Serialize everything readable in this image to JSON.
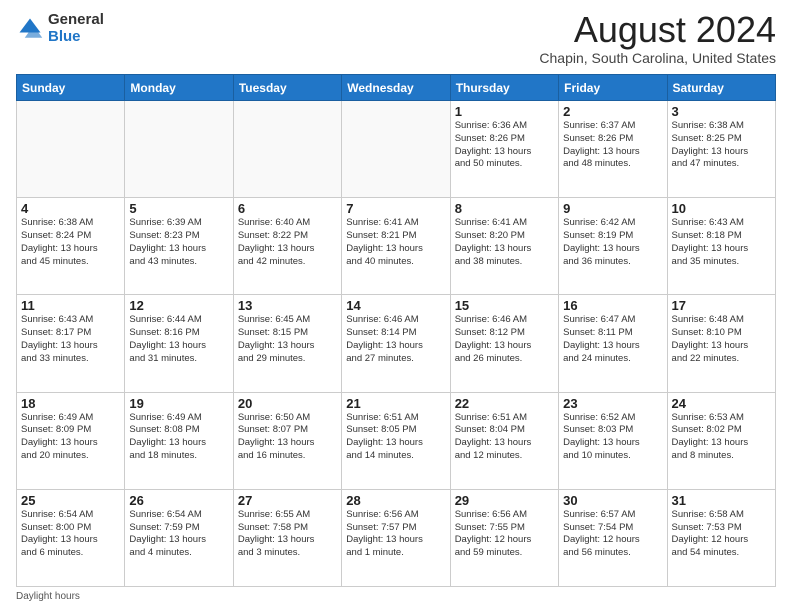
{
  "header": {
    "logo_general": "General",
    "logo_blue": "Blue",
    "month_year": "August 2024",
    "location": "Chapin, South Carolina, United States"
  },
  "days_of_week": [
    "Sunday",
    "Monday",
    "Tuesday",
    "Wednesday",
    "Thursday",
    "Friday",
    "Saturday"
  ],
  "weeks": [
    [
      {
        "day": "",
        "info": ""
      },
      {
        "day": "",
        "info": ""
      },
      {
        "day": "",
        "info": ""
      },
      {
        "day": "",
        "info": ""
      },
      {
        "day": "1",
        "info": "Sunrise: 6:36 AM\nSunset: 8:26 PM\nDaylight: 13 hours\nand 50 minutes."
      },
      {
        "day": "2",
        "info": "Sunrise: 6:37 AM\nSunset: 8:26 PM\nDaylight: 13 hours\nand 48 minutes."
      },
      {
        "day": "3",
        "info": "Sunrise: 6:38 AM\nSunset: 8:25 PM\nDaylight: 13 hours\nand 47 minutes."
      }
    ],
    [
      {
        "day": "4",
        "info": "Sunrise: 6:38 AM\nSunset: 8:24 PM\nDaylight: 13 hours\nand 45 minutes."
      },
      {
        "day": "5",
        "info": "Sunrise: 6:39 AM\nSunset: 8:23 PM\nDaylight: 13 hours\nand 43 minutes."
      },
      {
        "day": "6",
        "info": "Sunrise: 6:40 AM\nSunset: 8:22 PM\nDaylight: 13 hours\nand 42 minutes."
      },
      {
        "day": "7",
        "info": "Sunrise: 6:41 AM\nSunset: 8:21 PM\nDaylight: 13 hours\nand 40 minutes."
      },
      {
        "day": "8",
        "info": "Sunrise: 6:41 AM\nSunset: 8:20 PM\nDaylight: 13 hours\nand 38 minutes."
      },
      {
        "day": "9",
        "info": "Sunrise: 6:42 AM\nSunset: 8:19 PM\nDaylight: 13 hours\nand 36 minutes."
      },
      {
        "day": "10",
        "info": "Sunrise: 6:43 AM\nSunset: 8:18 PM\nDaylight: 13 hours\nand 35 minutes."
      }
    ],
    [
      {
        "day": "11",
        "info": "Sunrise: 6:43 AM\nSunset: 8:17 PM\nDaylight: 13 hours\nand 33 minutes."
      },
      {
        "day": "12",
        "info": "Sunrise: 6:44 AM\nSunset: 8:16 PM\nDaylight: 13 hours\nand 31 minutes."
      },
      {
        "day": "13",
        "info": "Sunrise: 6:45 AM\nSunset: 8:15 PM\nDaylight: 13 hours\nand 29 minutes."
      },
      {
        "day": "14",
        "info": "Sunrise: 6:46 AM\nSunset: 8:14 PM\nDaylight: 13 hours\nand 27 minutes."
      },
      {
        "day": "15",
        "info": "Sunrise: 6:46 AM\nSunset: 8:12 PM\nDaylight: 13 hours\nand 26 minutes."
      },
      {
        "day": "16",
        "info": "Sunrise: 6:47 AM\nSunset: 8:11 PM\nDaylight: 13 hours\nand 24 minutes."
      },
      {
        "day": "17",
        "info": "Sunrise: 6:48 AM\nSunset: 8:10 PM\nDaylight: 13 hours\nand 22 minutes."
      }
    ],
    [
      {
        "day": "18",
        "info": "Sunrise: 6:49 AM\nSunset: 8:09 PM\nDaylight: 13 hours\nand 20 minutes."
      },
      {
        "day": "19",
        "info": "Sunrise: 6:49 AM\nSunset: 8:08 PM\nDaylight: 13 hours\nand 18 minutes."
      },
      {
        "day": "20",
        "info": "Sunrise: 6:50 AM\nSunset: 8:07 PM\nDaylight: 13 hours\nand 16 minutes."
      },
      {
        "day": "21",
        "info": "Sunrise: 6:51 AM\nSunset: 8:05 PM\nDaylight: 13 hours\nand 14 minutes."
      },
      {
        "day": "22",
        "info": "Sunrise: 6:51 AM\nSunset: 8:04 PM\nDaylight: 13 hours\nand 12 minutes."
      },
      {
        "day": "23",
        "info": "Sunrise: 6:52 AM\nSunset: 8:03 PM\nDaylight: 13 hours\nand 10 minutes."
      },
      {
        "day": "24",
        "info": "Sunrise: 6:53 AM\nSunset: 8:02 PM\nDaylight: 13 hours\nand 8 minutes."
      }
    ],
    [
      {
        "day": "25",
        "info": "Sunrise: 6:54 AM\nSunset: 8:00 PM\nDaylight: 13 hours\nand 6 minutes."
      },
      {
        "day": "26",
        "info": "Sunrise: 6:54 AM\nSunset: 7:59 PM\nDaylight: 13 hours\nand 4 minutes."
      },
      {
        "day": "27",
        "info": "Sunrise: 6:55 AM\nSunset: 7:58 PM\nDaylight: 13 hours\nand 3 minutes."
      },
      {
        "day": "28",
        "info": "Sunrise: 6:56 AM\nSunset: 7:57 PM\nDaylight: 13 hours\nand 1 minute."
      },
      {
        "day": "29",
        "info": "Sunrise: 6:56 AM\nSunset: 7:55 PM\nDaylight: 12 hours\nand 59 minutes."
      },
      {
        "day": "30",
        "info": "Sunrise: 6:57 AM\nSunset: 7:54 PM\nDaylight: 12 hours\nand 56 minutes."
      },
      {
        "day": "31",
        "info": "Sunrise: 6:58 AM\nSunset: 7:53 PM\nDaylight: 12 hours\nand 54 minutes."
      }
    ]
  ],
  "footer": {
    "daylight_hours_label": "Daylight hours"
  }
}
